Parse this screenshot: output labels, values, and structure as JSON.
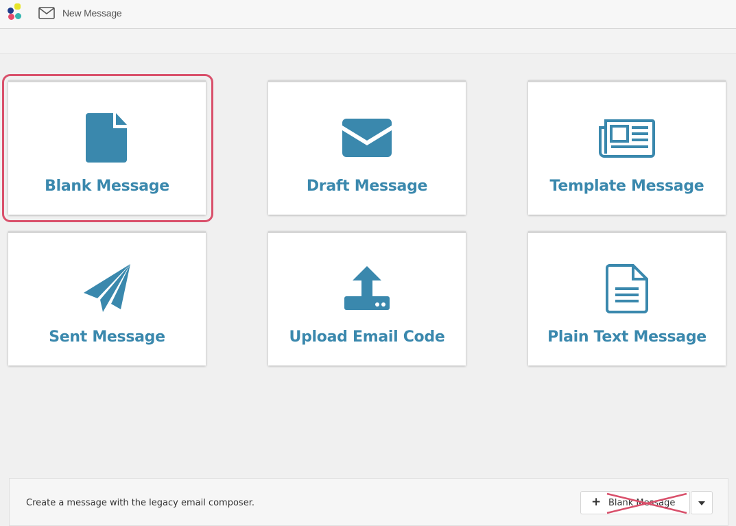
{
  "header": {
    "title": "New Message",
    "logo_icon": "app-logo",
    "title_icon": "envelope-outline-icon"
  },
  "cards": [
    {
      "label": "Blank Message",
      "icon": "file-icon",
      "selected": true
    },
    {
      "label": "Draft Message",
      "icon": "envelope-icon",
      "selected": false
    },
    {
      "label": "Template Message",
      "icon": "newspaper-icon",
      "selected": false
    },
    {
      "label": "Sent Message",
      "icon": "paper-plane-icon",
      "selected": false
    },
    {
      "label": "Upload Email Code",
      "icon": "upload-icon",
      "selected": false
    },
    {
      "label": "Plain Text Message",
      "icon": "text-file-icon",
      "selected": false
    }
  ],
  "footer": {
    "text": "Create a message with the legacy email composer.",
    "button_label": "Blank Message",
    "button_struck_out": true
  },
  "colors": {
    "accent": "#3a88ad",
    "highlight": "#d9506b",
    "strike": "#d9506b"
  }
}
